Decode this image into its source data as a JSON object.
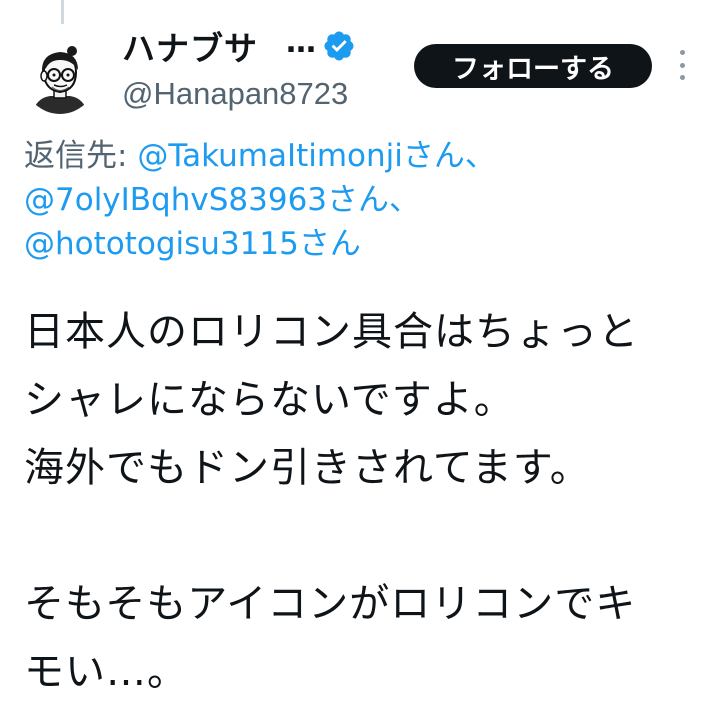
{
  "tweet": {
    "display_name": "ハナブサ",
    "name_ellipsis": "…",
    "handle": "@Hanapan8723",
    "follow_label": "フォローする",
    "reply": {
      "prefix": "返信先: ",
      "mentions": [
        {
          "handle": "@TakumaItimonji",
          "suffix": "さん、"
        },
        {
          "handle": "@7olyIBqhvS83963",
          "suffix": "さん、"
        },
        {
          "handle": "@hototogisu3115",
          "suffix": "さん"
        }
      ]
    },
    "text_lines": [
      "日本人のロリコン具合はちょっと",
      "シャレにならないですよ。",
      "海外でもドン引きされてます。",
      "",
      "そもそもアイコンがロリコンでキ",
      "モい…。"
    ],
    "colors": {
      "link": "#1d9bf0",
      "secondary_text": "#536471",
      "primary_text": "#0f1419",
      "button_bg": "#0f1419",
      "button_text": "#ffffff",
      "verified": "#1d9bf0"
    },
    "icons": {
      "verified": "verified-badge-icon",
      "more": "more-vertical-icon",
      "avatar": "cartoon-avatar"
    }
  }
}
